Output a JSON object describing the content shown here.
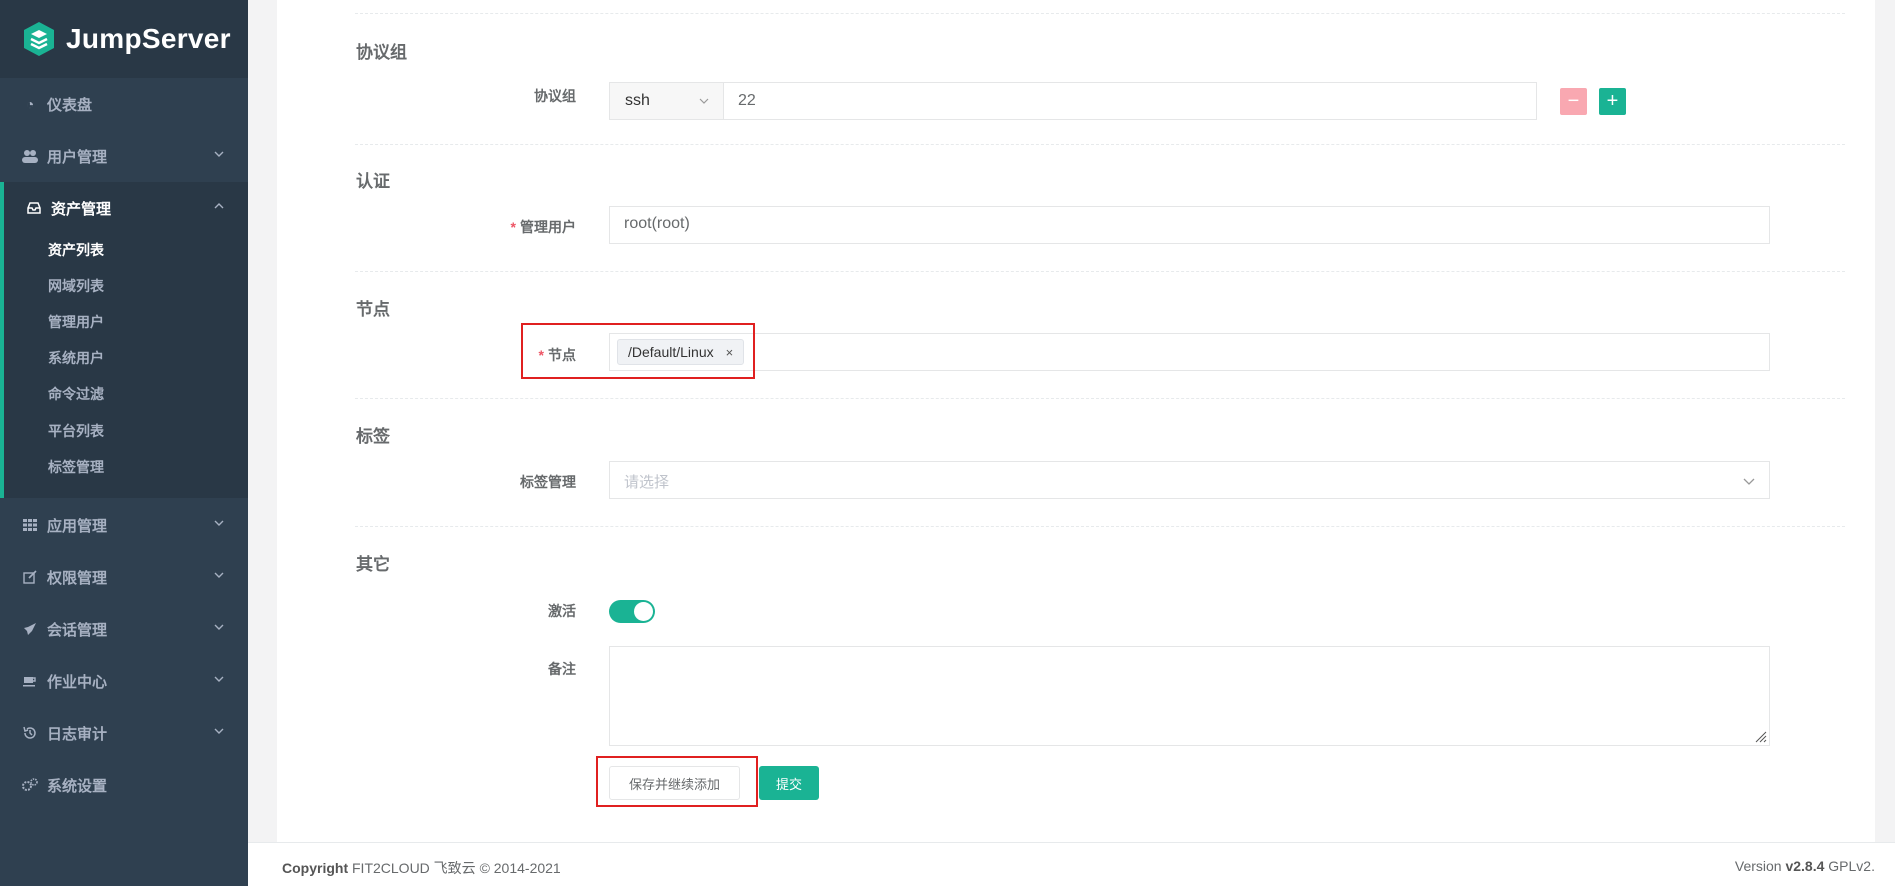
{
  "app": {
    "name": "JumpServer"
  },
  "sidebar": {
    "dashboard": "仪表盘",
    "users": "用户管理",
    "assets": "资产管理",
    "asset_sub": [
      "资产列表",
      "网域列表",
      "管理用户",
      "系统用户",
      "命令过滤",
      "平台列表",
      "标签管理"
    ],
    "applications": "应用管理",
    "perms": "权限管理",
    "sessions": "会话管理",
    "ops": "作业中心",
    "audits": "日志审计",
    "settings": "系统设置"
  },
  "form": {
    "protocol_section": "协议组",
    "protocol_label": "协议组",
    "protocol_value": "ssh",
    "port_value": "22",
    "auth_section": "认证",
    "admin_user_label": "管理用户",
    "admin_user_value": "root(root)",
    "node_section": "节点",
    "node_label": "节点",
    "node_tag": "/Default/Linux",
    "tag_remove": "×",
    "labels_section": "标签",
    "labels_label": "标签管理",
    "labels_placeholder": "请选择",
    "other_section": "其它",
    "active_label": "激活",
    "active_value": true,
    "comment_label": "备注",
    "required_mark": "*",
    "minus": "−",
    "plus": "+",
    "save_continue": "保存并继续添加",
    "submit": "提交"
  },
  "footer": {
    "copyright_bold": "Copyright",
    "copyright_text": " FIT2CLOUD 飞致云 © 2014-2021",
    "version_prefix": "Version ",
    "version": "v2.8.4",
    "license": " GPLv2."
  },
  "colors": {
    "sidebar": "#2f4050",
    "accent": "#1ab394",
    "highlight": "#e02020"
  }
}
